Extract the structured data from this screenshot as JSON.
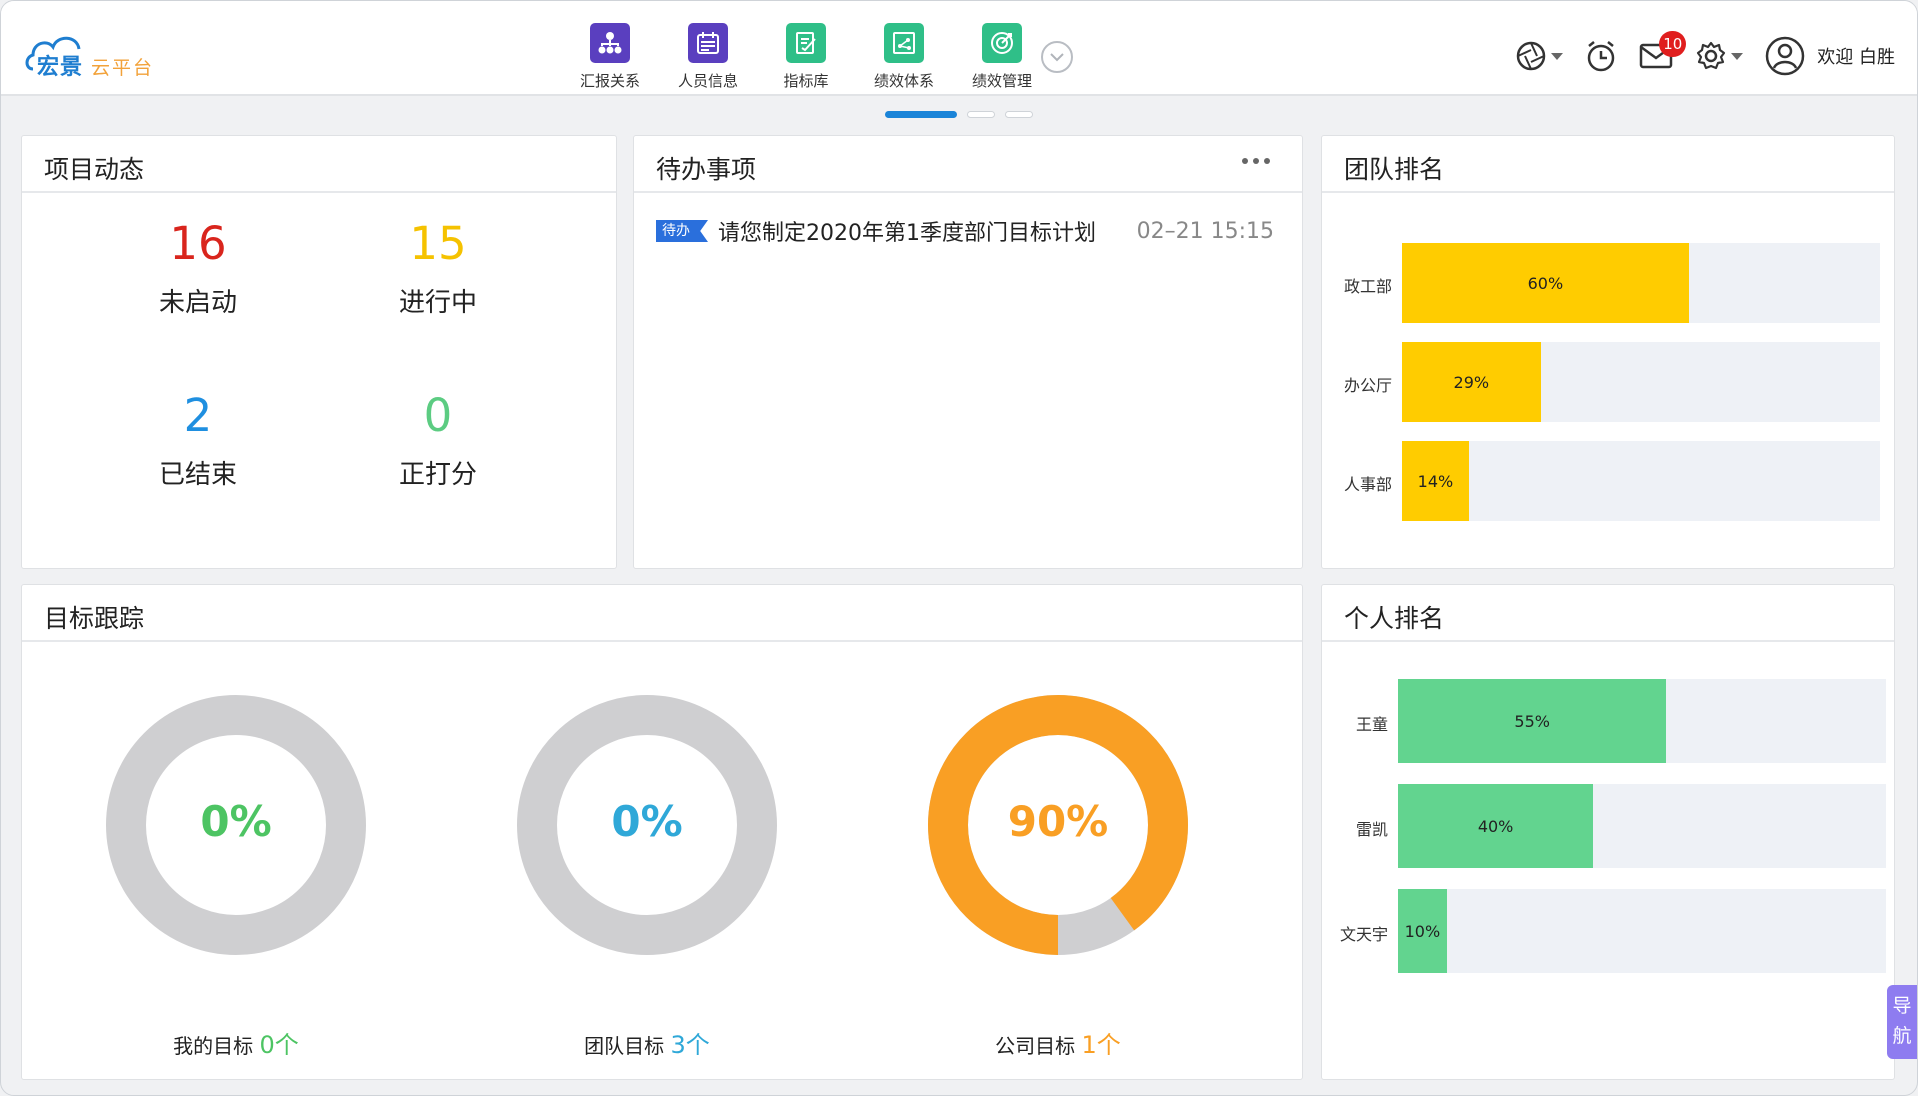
{
  "header": {
    "logo_primary": "宏景",
    "logo_secondary": "云平台",
    "nav": [
      {
        "label": "汇报关系",
        "icon": "org-chart-icon",
        "color": "#5a3fbf"
      },
      {
        "label": "人员信息",
        "icon": "calendar-card-icon",
        "color": "#5a3fbf"
      },
      {
        "label": "指标库",
        "icon": "clipboard-pen-icon",
        "color": "#2fbf88"
      },
      {
        "label": "绩效体系",
        "icon": "chart-network-icon",
        "color": "#2fbf88"
      },
      {
        "label": "绩效管理",
        "icon": "target-icon",
        "color": "#2fbf88"
      }
    ],
    "mail_badge": "10",
    "welcome": "欢迎 白胜"
  },
  "project": {
    "title": "项目动态",
    "stats": [
      {
        "value": "16",
        "label": "未启动",
        "color": "#d9251d"
      },
      {
        "value": "15",
        "label": "进行中",
        "color": "#f5c200"
      },
      {
        "value": "2",
        "label": "已结束",
        "color": "#1f8fe0"
      },
      {
        "value": "0",
        "label": "正打分",
        "color": "#5ccc82"
      }
    ]
  },
  "todo": {
    "title": "待办事项",
    "items": [
      {
        "tag": "待办",
        "text": "请您制定2020年第1季度部门目标计划",
        "time": "02–21 15:15"
      }
    ]
  },
  "team_rank": {
    "title": "团队排名",
    "color": "#ffcc00",
    "rows": [
      {
        "name": "政工部",
        "value": 60,
        "label": "60%"
      },
      {
        "name": "办公厅",
        "value": 29,
        "label": "29%"
      },
      {
        "name": "人事部",
        "value": 14,
        "label": "14%"
      }
    ]
  },
  "goals": {
    "title": "目标跟踪",
    "items": [
      {
        "percent": 0,
        "percent_label": "0%",
        "color": "#4dc463",
        "caption": "我的目标",
        "count": "0个"
      },
      {
        "percent": 0,
        "percent_label": "0%",
        "color": "#2fa8d8",
        "caption": "团队目标",
        "count": "3个"
      },
      {
        "percent": 90,
        "percent_label": "90%",
        "color": "#f99f24",
        "caption": "公司目标",
        "count": "1个"
      }
    ]
  },
  "person_rank": {
    "title": "个人排名",
    "color": "#62d48f",
    "rows": [
      {
        "name": "王童",
        "value": 55,
        "label": "55%"
      },
      {
        "name": "雷凯",
        "value": 40,
        "label": "40%"
      },
      {
        "name": "文天宇",
        "value": 10,
        "label": "10%"
      }
    ]
  },
  "side_nav": "导航"
}
